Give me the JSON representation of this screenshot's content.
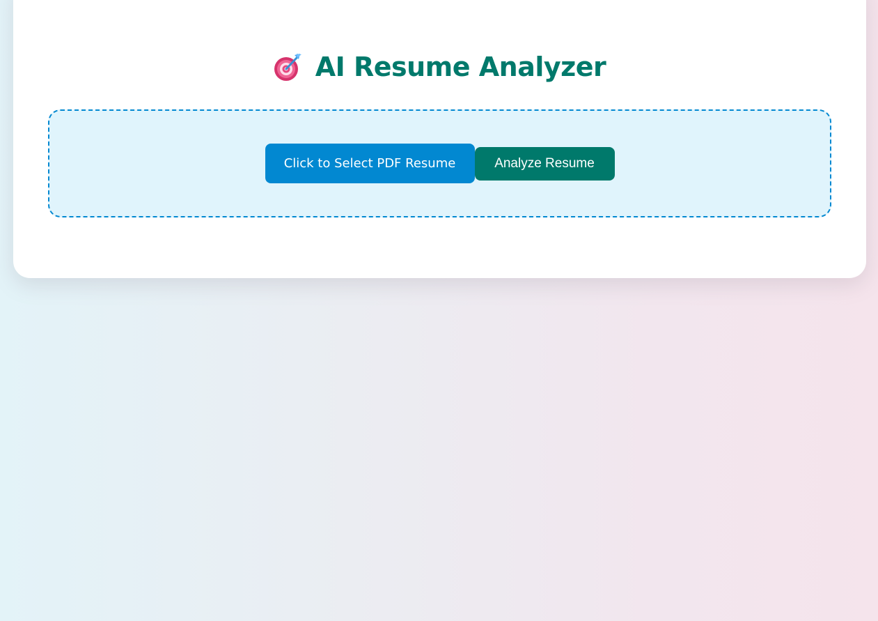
{
  "header": {
    "icon": "target-dart-icon",
    "title": "AI Resume Analyzer"
  },
  "upload": {
    "select_label": "Click to Select PDF Resume",
    "analyze_label": "Analyze Resume"
  },
  "colors": {
    "accent_teal": "#00796b",
    "accent_blue": "#0288d1",
    "upload_bg": "#e0f4fc",
    "card_bg": "#ffffff"
  }
}
